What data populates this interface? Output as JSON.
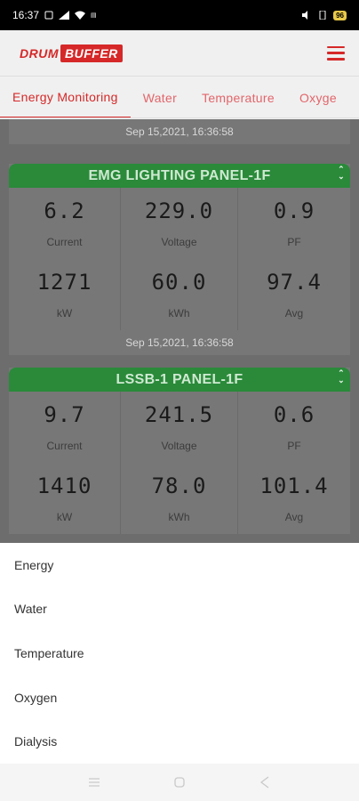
{
  "status_bar": {
    "time": "16:37",
    "net_icon": "network-speed-icon",
    "battery": "96"
  },
  "header": {
    "logo_part1": "DRUM",
    "logo_part2": "BUFFER"
  },
  "tabs": [
    {
      "label": "Energy Monitoring"
    },
    {
      "label": "Water"
    },
    {
      "label": "Temperature"
    },
    {
      "label": "Oxyge"
    }
  ],
  "content": {
    "timestamp_top": "Sep 15,2021, 16:36:58",
    "panels": [
      {
        "title": "EMG LIGHTING PANEL-1F",
        "metrics": [
          {
            "value": "6.2",
            "label": "Current"
          },
          {
            "value": "229.0",
            "label": "Voltage"
          },
          {
            "value": "0.9",
            "label": "PF"
          },
          {
            "value": "1271",
            "label": "kW"
          },
          {
            "value": "60.0",
            "label": "kWh"
          },
          {
            "value": "97.4",
            "label": "Avg"
          }
        ],
        "timestamp": "Sep 15,2021, 16:36:58"
      },
      {
        "title": "LSSB-1 PANEL-1F",
        "metrics": [
          {
            "value": "9.7",
            "label": "Current"
          },
          {
            "value": "241.5",
            "label": "Voltage"
          },
          {
            "value": "0.6",
            "label": "PF"
          },
          {
            "value": "1410",
            "label": "kW"
          },
          {
            "value": "78.0",
            "label": "kWh"
          },
          {
            "value": "101.4",
            "label": "Avg"
          }
        ]
      }
    ]
  },
  "sheet": {
    "items": [
      {
        "label": "Energy"
      },
      {
        "label": "Water"
      },
      {
        "label": "Temperature"
      },
      {
        "label": "Oxygen"
      },
      {
        "label": "Dialysis"
      }
    ]
  },
  "colors": {
    "brand": "#d62828",
    "panel_header": "#2a8a3a"
  }
}
